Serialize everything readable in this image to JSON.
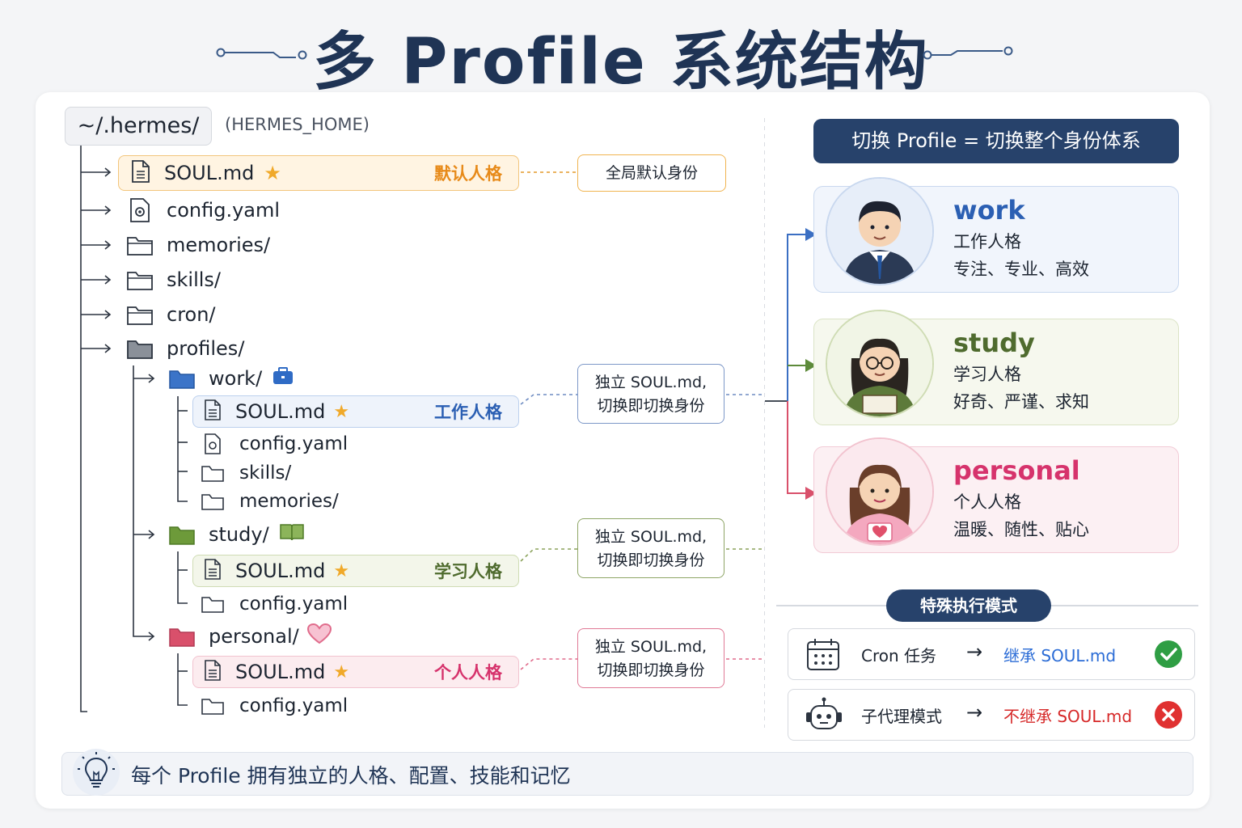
{
  "title": "多 Profile 系统结构",
  "root": {
    "path": "~/.hermes/",
    "env": "(HERMES_HOME)"
  },
  "tree": {
    "soul": {
      "name": "SOUL.md",
      "tag": "默认人格",
      "note": "全局默认身份"
    },
    "config": "config.yaml",
    "memories": "memories/",
    "skills": "skills/",
    "cron": "cron/",
    "profiles": "profiles/",
    "work": {
      "name": "work/",
      "soul": "SOUL.md",
      "tag": "工作人格",
      "config": "config.yaml",
      "skills": "skills/",
      "memories": "memories/",
      "note1": "独立 SOUL.md,",
      "note2": "切换即切换身份"
    },
    "study": {
      "name": "study/",
      "soul": "SOUL.md",
      "tag": "学习人格",
      "config": "config.yaml",
      "note1": "独立 SOUL.md,",
      "note2": "切换即切换身份"
    },
    "personal": {
      "name": "personal/",
      "soul": "SOUL.md",
      "tag": "个人人格",
      "config": "config.yaml",
      "note1": "独立 SOUL.md,",
      "note2": "切换即切换身份"
    }
  },
  "switch_banner": "切换 Profile = 切换整个身份体系",
  "profiles": [
    {
      "name": "work",
      "role": "工作人格",
      "desc": "专注、专业、高效",
      "color": "#2b5fb3"
    },
    {
      "name": "study",
      "role": "学习人格",
      "desc": "好奇、严谨、求知",
      "color": "#4f6b2e"
    },
    {
      "name": "personal",
      "role": "个人人格",
      "desc": "温暖、随性、贴心",
      "color": "#d6336c"
    }
  ],
  "special": {
    "title": "特殊执行模式",
    "cron": {
      "label": "Cron 任务",
      "arrow": "→",
      "value": "继承 SOUL.md",
      "color": "#2b6cd6",
      "status_icon": "check-icon"
    },
    "subagent": {
      "label": "子代理模式",
      "arrow": "→",
      "value": "不继承 SOUL.md",
      "color": "#d62828",
      "status_icon": "cross-icon"
    }
  },
  "tip": "每个 Profile 拥有独立的人格、配置、技能和记忆"
}
